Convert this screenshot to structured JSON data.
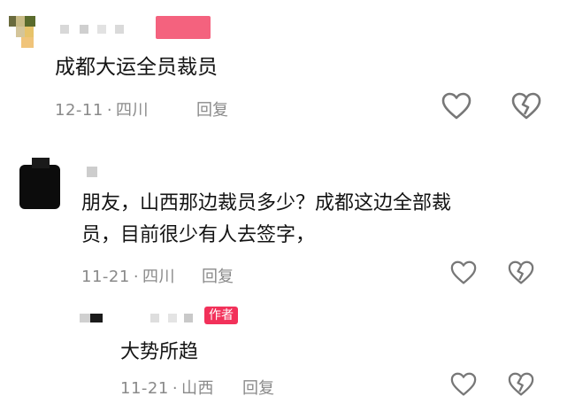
{
  "comments": [
    {
      "text": "成都大运全员裁员",
      "date": "12-11",
      "location": "四川",
      "reply_label": "回复"
    },
    {
      "text_line1": "朋友，山西那边裁员多少？成都这边全部裁",
      "text_line2": "员，目前很少有人去签字，",
      "date": "11-21",
      "location": "四川",
      "reply_label": "回复"
    },
    {
      "author_badge": "作者",
      "text": "大势所趋",
      "date": "11-21",
      "location": "山西",
      "reply_label": "回复"
    }
  ],
  "icons": [
    "heart-outline-icon",
    "broken-heart-icon"
  ],
  "colors": {
    "accent": "#f2315a",
    "meta": "#8a8a8a",
    "text": "#141414"
  }
}
